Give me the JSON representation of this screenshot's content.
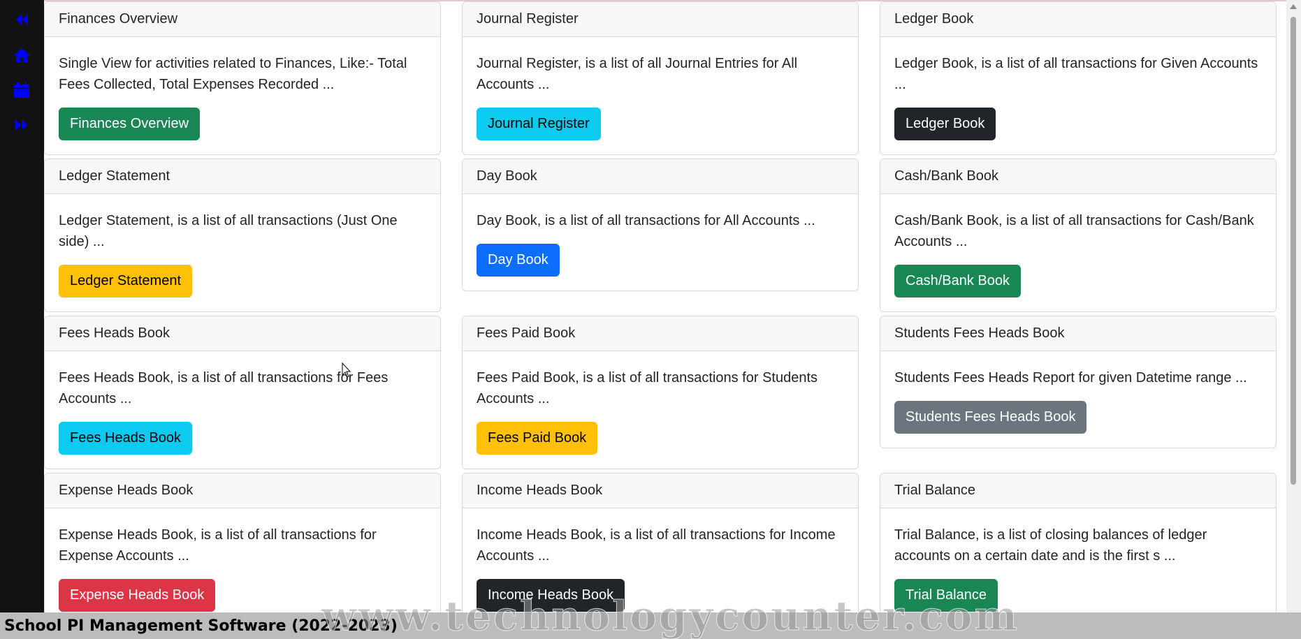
{
  "footer": {
    "title": "School PI Management Software (2022-2023)"
  },
  "watermark": "www.technologycounter.com",
  "sidebar": {
    "icons": [
      "double-chevron-left-icon",
      "home-icon",
      "calendar-icon",
      "double-chevron-right-icon"
    ],
    "icon_color": "#0000ff"
  },
  "cards": [
    {
      "title": "Finances Overview",
      "text": "Single View for activities related to Finances, Like:- Total Fees Collected, Total Expenses Recorded ...",
      "button": "Finances Overview",
      "variant": "success"
    },
    {
      "title": "Journal Register",
      "text": "Journal Register, is a list of all Journal Entries for All Accounts ...",
      "button": "Journal Register",
      "variant": "info"
    },
    {
      "title": "Ledger Book",
      "text": "Ledger Book, is a list of all transactions for Given Accounts ...",
      "button": "Ledger Book",
      "variant": "dark"
    },
    {
      "title": "Ledger Statement",
      "text": "Ledger Statement, is a list of all transactions (Just One side) ...",
      "button": "Ledger Statement",
      "variant": "warning"
    },
    {
      "title": "Day Book",
      "text": "Day Book, is a list of all transactions for All Accounts ...",
      "button": "Day Book",
      "variant": "primary"
    },
    {
      "title": "Cash/Bank Book",
      "text": "Cash/Bank Book, is a list of all transactions for Cash/Bank Accounts ...",
      "button": "Cash/Bank Book",
      "variant": "success"
    },
    {
      "title": "Fees Heads Book",
      "text": "Fees Heads Book, is a list of all transactions for Fees Accounts ...",
      "button": "Fees Heads Book",
      "variant": "info"
    },
    {
      "title": "Fees Paid Book",
      "text": "Fees Paid Book, is a list of all transactions for Students Accounts ...",
      "button": "Fees Paid Book",
      "variant": "warning"
    },
    {
      "title": "Students Fees Heads Book",
      "text": "Students Fees Heads Report for given Datetime range ...",
      "button": "Students Fees Heads Book",
      "variant": "secondary"
    },
    {
      "title": "Expense Heads Book",
      "text": "Expense Heads Book, is a list of all transactions for Expense Accounts ...",
      "button": "Expense Heads Book",
      "variant": "danger"
    },
    {
      "title": "Income Heads Book",
      "text": "Income Heads Book, is a list of all transactions for Income Accounts ...",
      "button": "Income Heads Book",
      "variant": "dark"
    },
    {
      "title": "Trial Balance",
      "text": "Trial Balance, is a list of closing balances of ledger accounts on a certain date and is the first s ...",
      "button": "Trial Balance",
      "variant": "success"
    }
  ]
}
